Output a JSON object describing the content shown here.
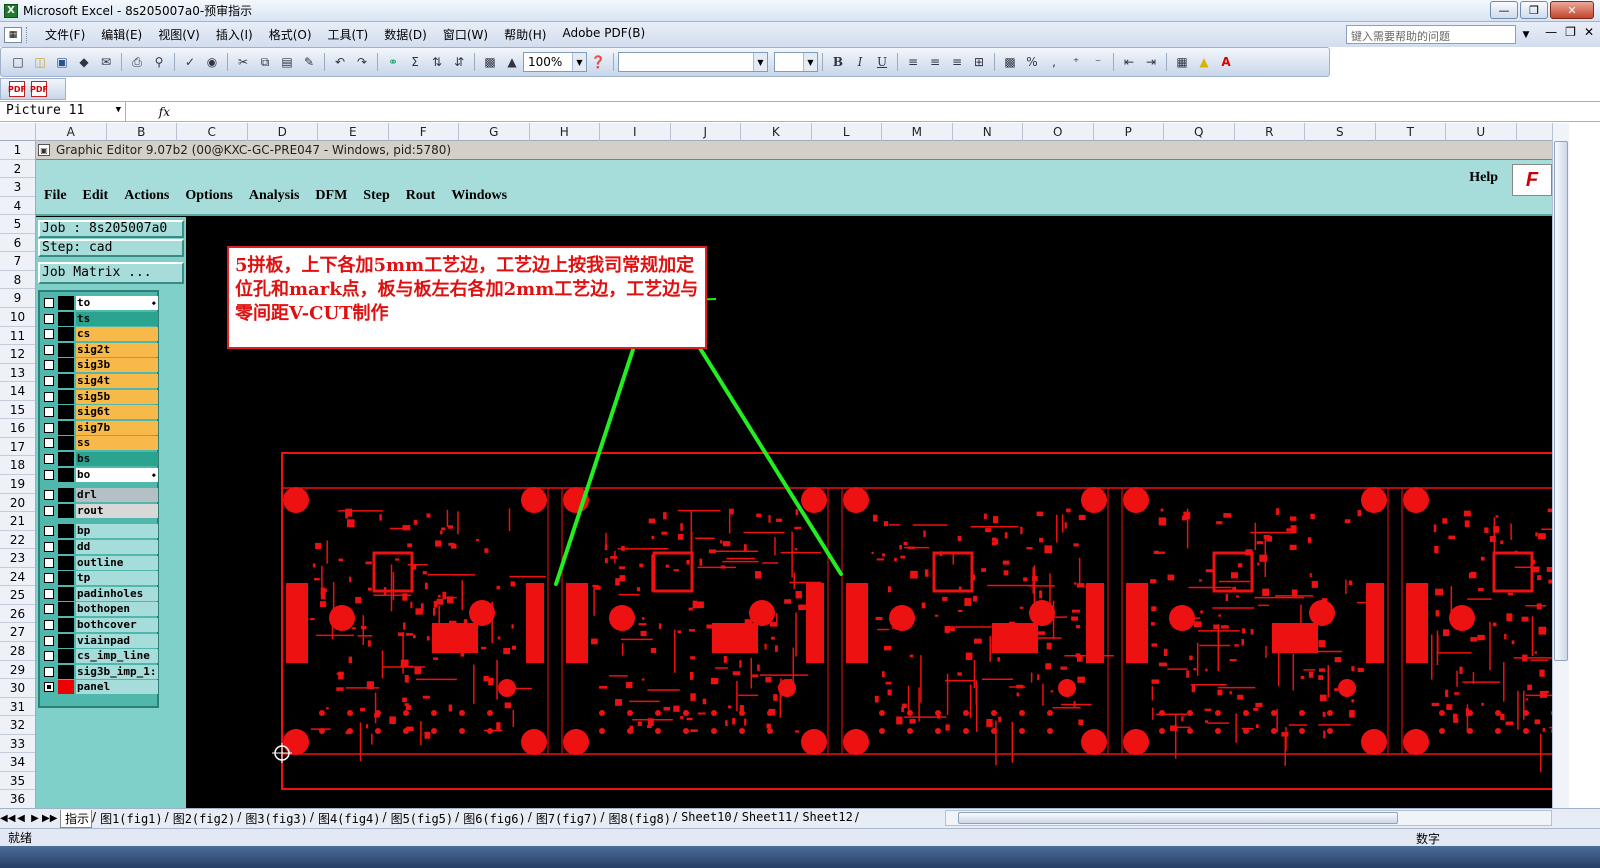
{
  "window": {
    "title": "Microsoft Excel - 8s205007a0-预审指示",
    "app_icon": "excel-icon"
  },
  "menubar": {
    "items": [
      "文件(F)",
      "编辑(E)",
      "视图(V)",
      "插入(I)",
      "格式(O)",
      "工具(T)",
      "数据(D)",
      "窗口(W)",
      "帮助(H)",
      "Adobe PDF(B)"
    ],
    "help_placeholder": "键入需要帮助的问题"
  },
  "toolbar": {
    "zoom": "100%",
    "font_name": "",
    "font_size": "",
    "bold": "B",
    "italic": "I",
    "underline": "U"
  },
  "formula_bar": {
    "name_box": "Picture 11",
    "fx": "fx"
  },
  "columns": [
    "A",
    "B",
    "C",
    "D",
    "E",
    "F",
    "G",
    "H",
    "I",
    "J",
    "K",
    "L",
    "M",
    "N",
    "O",
    "P",
    "Q",
    "R",
    "S",
    "T",
    "U"
  ],
  "rows": [
    "1",
    "2",
    "3",
    "4",
    "5",
    "6",
    "7",
    "8",
    "9",
    "10",
    "11",
    "12",
    "13",
    "14",
    "15",
    "16",
    "17",
    "18",
    "19",
    "20",
    "21",
    "22",
    "23",
    "24",
    "25",
    "26",
    "27",
    "28",
    "29",
    "30",
    "31",
    "32",
    "33",
    "34",
    "35",
    "36"
  ],
  "graphic_editor": {
    "title": "Graphic Editor 9.07b2 (00@KXC-GC-PRE047 - Windows, pid:5780)",
    "menu": [
      "File",
      "Edit",
      "Actions",
      "Options",
      "Analysis",
      "DFM",
      "Step",
      "Rout",
      "Windows"
    ],
    "help": "Help",
    "logo": "F",
    "job": "Job : 8s205007a0",
    "step": "Step: cad",
    "job_matrix": "Job Matrix ...",
    "layers": [
      {
        "name": "to",
        "color": "#ffffff",
        "mark": true
      },
      {
        "name": "ts",
        "color": "#2aa38f",
        "mark": false
      },
      {
        "name": "cs",
        "color": "#f7b94a",
        "mark": false
      },
      {
        "name": "sig2t",
        "color": "#f7b94a",
        "mark": false
      },
      {
        "name": "sig3b",
        "color": "#f7b94a",
        "mark": false
      },
      {
        "name": "sig4t",
        "color": "#f7b94a",
        "mark": false
      },
      {
        "name": "sig5b",
        "color": "#f7b94a",
        "mark": false
      },
      {
        "name": "sig6t",
        "color": "#f7b94a",
        "mark": false
      },
      {
        "name": "sig7b",
        "color": "#f7b94a",
        "mark": false
      },
      {
        "name": "ss",
        "color": "#f7b94a",
        "mark": false
      },
      {
        "name": "bs",
        "color": "#2aa38f",
        "mark": false
      },
      {
        "name": "bo",
        "color": "#ffffff",
        "mark": true
      },
      {
        "name": "drl",
        "color": "#b5c0c4",
        "mark": false
      },
      {
        "name": "rout",
        "color": "#d8d8d8",
        "mark": false
      },
      {
        "name": "bp",
        "color": "#a6dcd9",
        "mark": false
      },
      {
        "name": "dd",
        "color": "#a6dcd9",
        "mark": false
      },
      {
        "name": "outline",
        "color": "#a6dcd9",
        "mark": false
      },
      {
        "name": "tp",
        "color": "#a6dcd9",
        "mark": false
      },
      {
        "name": "padinholes",
        "color": "#a6dcd9",
        "mark": false
      },
      {
        "name": "bothopen",
        "color": "#a6dcd9",
        "mark": false
      },
      {
        "name": "bothcover",
        "color": "#a6dcd9",
        "mark": false
      },
      {
        "name": "viainpad",
        "color": "#a6dcd9",
        "mark": false
      },
      {
        "name": "cs_imp_line",
        "color": "#a6dcd9",
        "mark": false
      },
      {
        "name": "sig3b_imp_1:",
        "color": "#a6dcd9",
        "mark": false
      },
      {
        "name": "panel",
        "color": "#a6dcd9",
        "mark": false,
        "active": true
      }
    ],
    "annotation": "5拼板，上下各加5mm工艺边，工艺边上按我司常规加定位孔和mark点，板与板左右各加2mm工艺边，工艺边与零间距V-CUT制作",
    "pcb_color": "#ee1111",
    "arrow_color": "#22ee22"
  },
  "sheet_tabs": [
    "指示",
    "图1(fig1)",
    "图2(fig2)",
    "图3(fig3)",
    "图4(fig4)",
    "图5(fig5)",
    "图6(fig6)",
    "图7(fig7)",
    "图8(fig8)",
    "Sheet10",
    "Sheet11",
    "Sheet12"
  ],
  "active_tab": 0,
  "status": {
    "ready": "就绪",
    "num": "数字"
  }
}
